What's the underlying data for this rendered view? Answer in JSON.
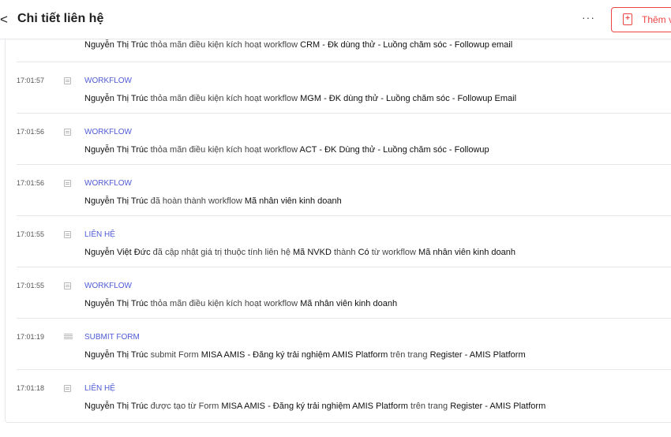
{
  "header": {
    "title": "Chi tiết liên hệ",
    "back_icon": "<",
    "more_icon": "···",
    "add_button_label": "Thêm v"
  },
  "rows": [
    {
      "time": "",
      "type": "",
      "icon": "workflow-icon",
      "actor": "Nguyễn Thị Trúc",
      "p1": "thỏa mãn điều kiện kích hoạt workflow",
      "o1": "CRM - Đk dùng thử - Luồng chăm sóc - Followup email",
      "p2": "",
      "o2": "",
      "p3": "",
      "o3": ""
    },
    {
      "time": "17:01:57",
      "type": "WORKFLOW",
      "icon": "workflow-icon",
      "actor": "Nguyễn Thị Trúc",
      "p1": "thỏa mãn điều kiện kích hoạt workflow",
      "o1": "MGM - ĐK dùng thử - Luồng chăm sóc - Followup Email",
      "p2": "",
      "o2": "",
      "p3": "",
      "o3": ""
    },
    {
      "time": "17:01:56",
      "type": "WORKFLOW",
      "icon": "workflow-icon",
      "actor": "Nguyễn Thị Trúc",
      "p1": "thỏa mãn điều kiện kích hoạt workflow",
      "o1": "ACT - ĐK Dùng thử - Luồng chăm sóc - Followup",
      "p2": "",
      "o2": "",
      "p3": "",
      "o3": ""
    },
    {
      "time": "17:01:56",
      "type": "WORKFLOW",
      "icon": "workflow-icon",
      "actor": "Nguyễn Thị Trúc",
      "p1": "đã hoàn thành workflow",
      "o1": "Mã nhân viên kinh doanh",
      "p2": "",
      "o2": "",
      "p3": "",
      "o3": ""
    },
    {
      "time": "17:01:55",
      "type": "LIÊN HỆ",
      "icon": "contact-icon",
      "actor": "Nguyễn Việt Đức",
      "p1": "đã cập nhật giá trị thuộc tính liên hệ",
      "o1": "Mã NVKD",
      "p2": "thành",
      "o2": "Có",
      "p3": "từ workflow",
      "o3": "Mã nhân viên kinh doanh"
    },
    {
      "time": "17:01:55",
      "type": "WORKFLOW",
      "icon": "workflow-icon",
      "actor": "Nguyễn Thị Trúc",
      "p1": "thỏa mãn điều kiện kích hoạt workflow",
      "o1": "Mã nhân viên kinh doanh",
      "p2": "",
      "o2": "",
      "p3": "",
      "o3": ""
    },
    {
      "time": "17:01:19",
      "type": "SUBMIT FORM",
      "icon": "form-icon",
      "actor": "Nguyễn Thị Trúc",
      "p1": "submit Form",
      "o1": "MISA AMIS - Đăng ký trải nghiệm AMIS Platform",
      "p2": "trên trang",
      "o2": "Register - AMIS Platform",
      "p3": "",
      "o3": ""
    },
    {
      "time": "17:01:18",
      "type": "LIÊN HỆ",
      "icon": "contact-icon",
      "actor": "Nguyễn Thị Trúc",
      "p1": "được tạo từ Form",
      "o1": "MISA AMIS - Đăng ký trải nghiệm AMIS Platform",
      "p2": "trên trang",
      "o2": "Register - AMIS Platform",
      "p3": "",
      "o3": ""
    }
  ]
}
